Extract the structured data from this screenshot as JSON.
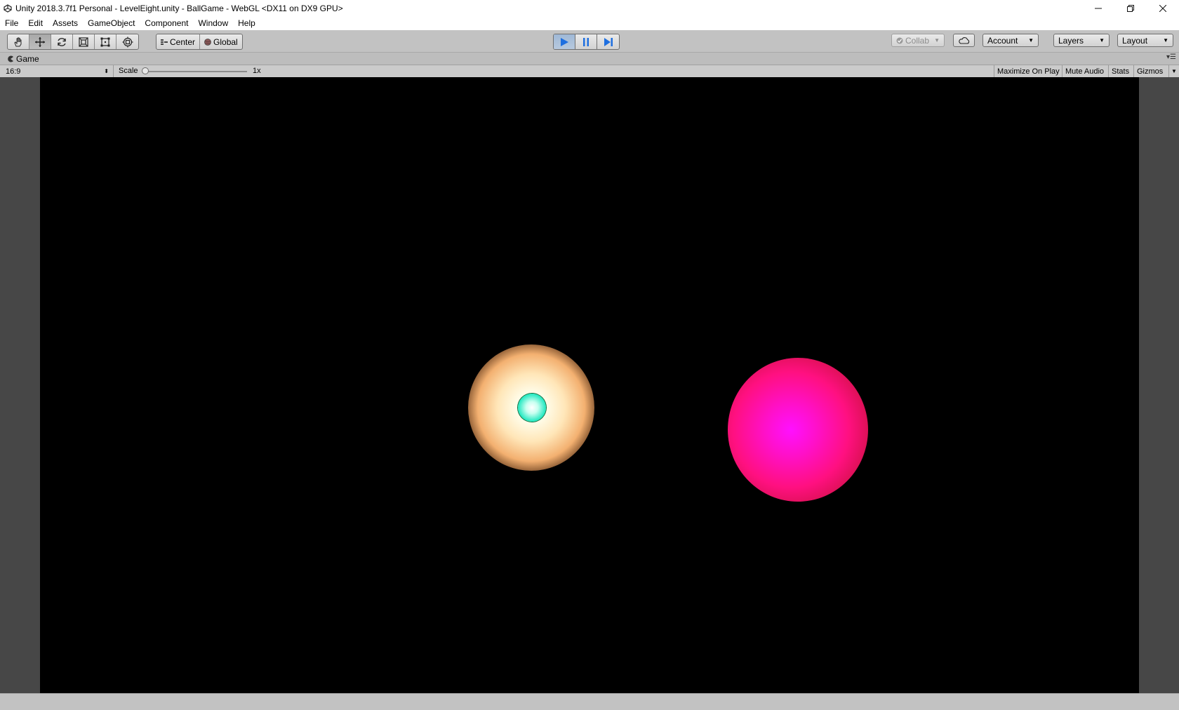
{
  "window": {
    "title": "Unity 2018.3.7f1 Personal - LevelEight.unity - BallGame - WebGL <DX11 on DX9 GPU>",
    "controls": [
      "minimize",
      "restore",
      "close"
    ]
  },
  "menu": {
    "items": [
      "File",
      "Edit",
      "Assets",
      "GameObject",
      "Component",
      "Window",
      "Help"
    ]
  },
  "toolbar": {
    "tools": [
      {
        "name": "hand-tool",
        "icon": "hand-icon",
        "active": false
      },
      {
        "name": "move-tool",
        "icon": "move-icon",
        "active": true
      },
      {
        "name": "rotate-tool",
        "icon": "rotate-icon",
        "active": false
      },
      {
        "name": "scale-tool",
        "icon": "scale-icon",
        "active": false
      },
      {
        "name": "rect-tool",
        "icon": "rect-icon",
        "active": false
      },
      {
        "name": "transform-tool",
        "icon": "transform-icon",
        "active": false
      }
    ],
    "pivot_label": "Center",
    "space_label": "Global",
    "play_active": true,
    "collab_label": "Collab",
    "account_label": "Account",
    "layers_label": "Layers",
    "layout_label": "Layout",
    "accent_color": "#1e6fe0"
  },
  "game_tab": {
    "label": "Game"
  },
  "game_toolbar": {
    "aspect": "16:9",
    "scale_label": "Scale",
    "scale_value": "1x",
    "maximize_label": "Maximize On Play",
    "mute_label": "Mute Audio",
    "stats_label": "Stats",
    "gizmos_label": "Gizmos"
  },
  "scene": {
    "background_color": "#000000",
    "objects": [
      {
        "name": "light-orb",
        "color": "#ffe6b8"
      },
      {
        "name": "player-ball",
        "color": "#20e8c0"
      },
      {
        "name": "pink-ball",
        "color": "#ff10a0"
      }
    ]
  }
}
